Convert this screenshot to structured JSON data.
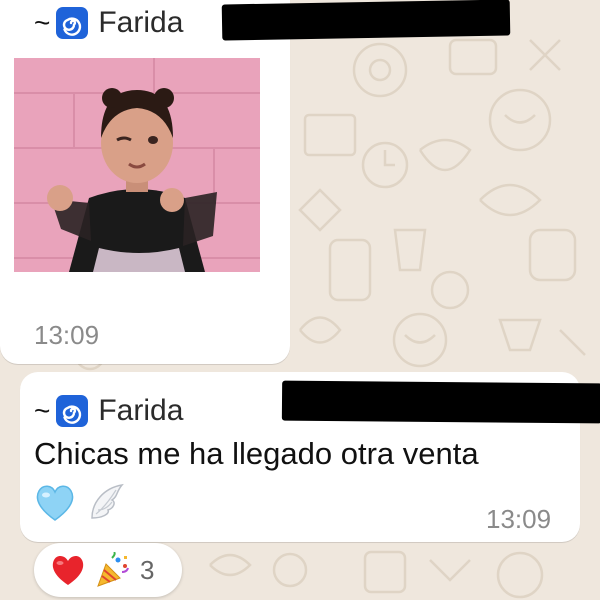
{
  "chat": {
    "messages": [
      {
        "type": "image",
        "sender_prefix": "~",
        "sender_icon": "spiral-emoji-icon",
        "sender_name": "Farida",
        "time": "13:09"
      },
      {
        "type": "text",
        "sender_prefix": "~",
        "sender_icon": "spiral-emoji-icon",
        "sender_name": "Farida",
        "text": "Chicas me ha llegado otra venta",
        "emojis": [
          "light-blue-heart-icon",
          "wing-icon"
        ],
        "time": "13:09",
        "reactions": {
          "icons": [
            "red-heart-icon",
            "party-popper-icon"
          ],
          "count": "3"
        }
      }
    ]
  },
  "colors": {
    "chat_background": "#efe7dd",
    "bubble": "#ffffff",
    "spiral": "#1f63d9",
    "time_text": "#8a8a8a"
  }
}
